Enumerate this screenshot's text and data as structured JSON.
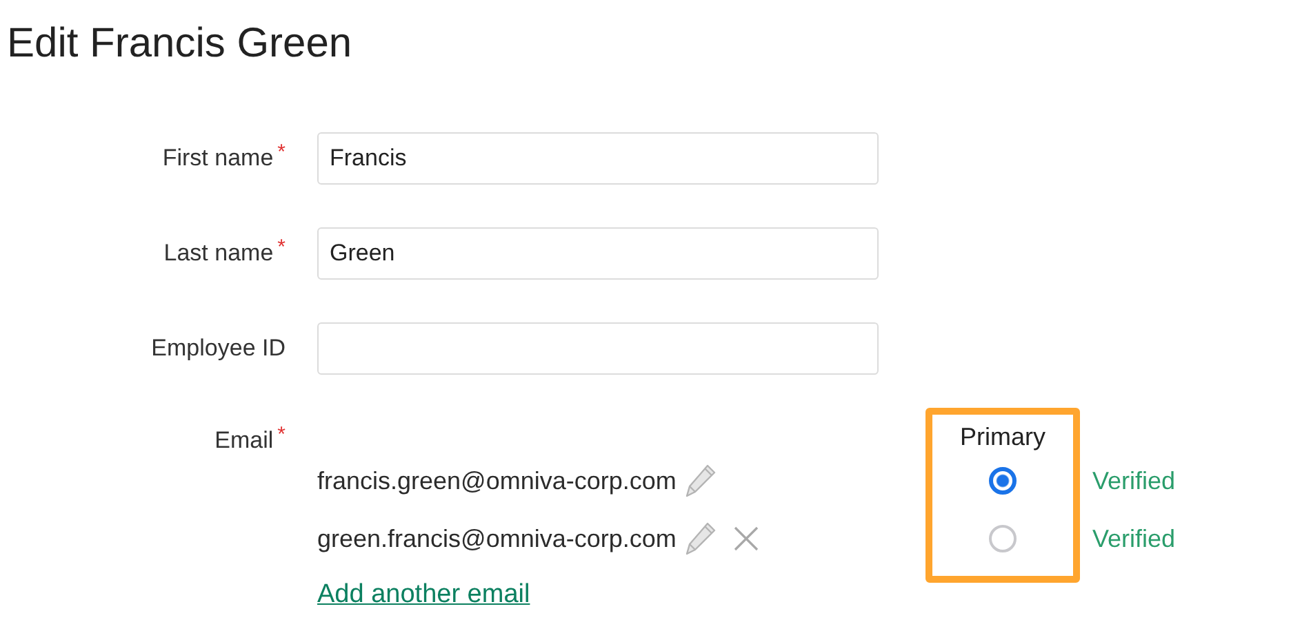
{
  "title": "Edit Francis Green",
  "required_marker": "*",
  "fields": [
    {
      "label": "First name",
      "required": true,
      "value": "Francis"
    },
    {
      "label": "Last name",
      "required": true,
      "value": "Green"
    },
    {
      "label": "Employee ID",
      "required": false
    }
  ],
  "email": {
    "label": "Email",
    "required": true,
    "primary_heading": "Primary",
    "addresses": [
      {
        "address": "francis.green@omniva-corp.com",
        "removable": false,
        "selected": true,
        "status": "Verified"
      },
      {
        "address": "green.francis@omniva-corp.com",
        "removable": true,
        "selected": false,
        "status": "Verified"
      }
    ],
    "add_link": "Add another email"
  }
}
